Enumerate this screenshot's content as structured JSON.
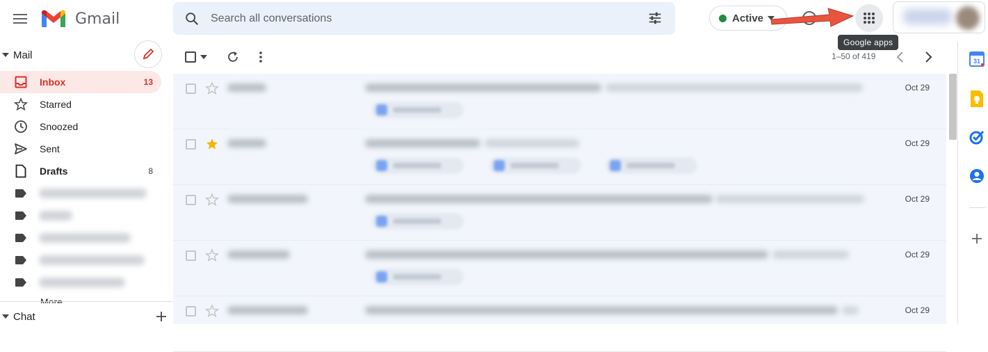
{
  "header": {
    "app_name": "Gmail",
    "search_placeholder": "Search all conversations",
    "status_label": "Active",
    "apps_tooltip": "Google apps"
  },
  "sidebar": {
    "mail_section": "Mail",
    "items": [
      {
        "label": "Inbox",
        "count": "13",
        "icon": "inbox-icon"
      },
      {
        "label": "Starred",
        "count": "",
        "icon": "star-outline-icon"
      },
      {
        "label": "Snoozed",
        "count": "",
        "icon": "clock-icon"
      },
      {
        "label": "Sent",
        "count": "",
        "icon": "send-icon"
      },
      {
        "label": "Drafts",
        "count": "8",
        "icon": "draft-icon"
      }
    ],
    "more_label": "More",
    "chat_section": "Chat"
  },
  "toolbar": {
    "pager": "1–50 of 419"
  },
  "emails": [
    {
      "date": "Oct 29",
      "starred": false
    },
    {
      "date": "Oct 29",
      "starred": true
    },
    {
      "date": "Oct 29",
      "starred": false
    },
    {
      "date": "Oct 29",
      "starred": false
    },
    {
      "date": "Oct 29",
      "starred": false
    }
  ],
  "colors": {
    "accent_red": "#d93025",
    "active_green": "#1e8e3e",
    "star_yellow": "#f4b400",
    "arrow_red": "#e8553e"
  }
}
